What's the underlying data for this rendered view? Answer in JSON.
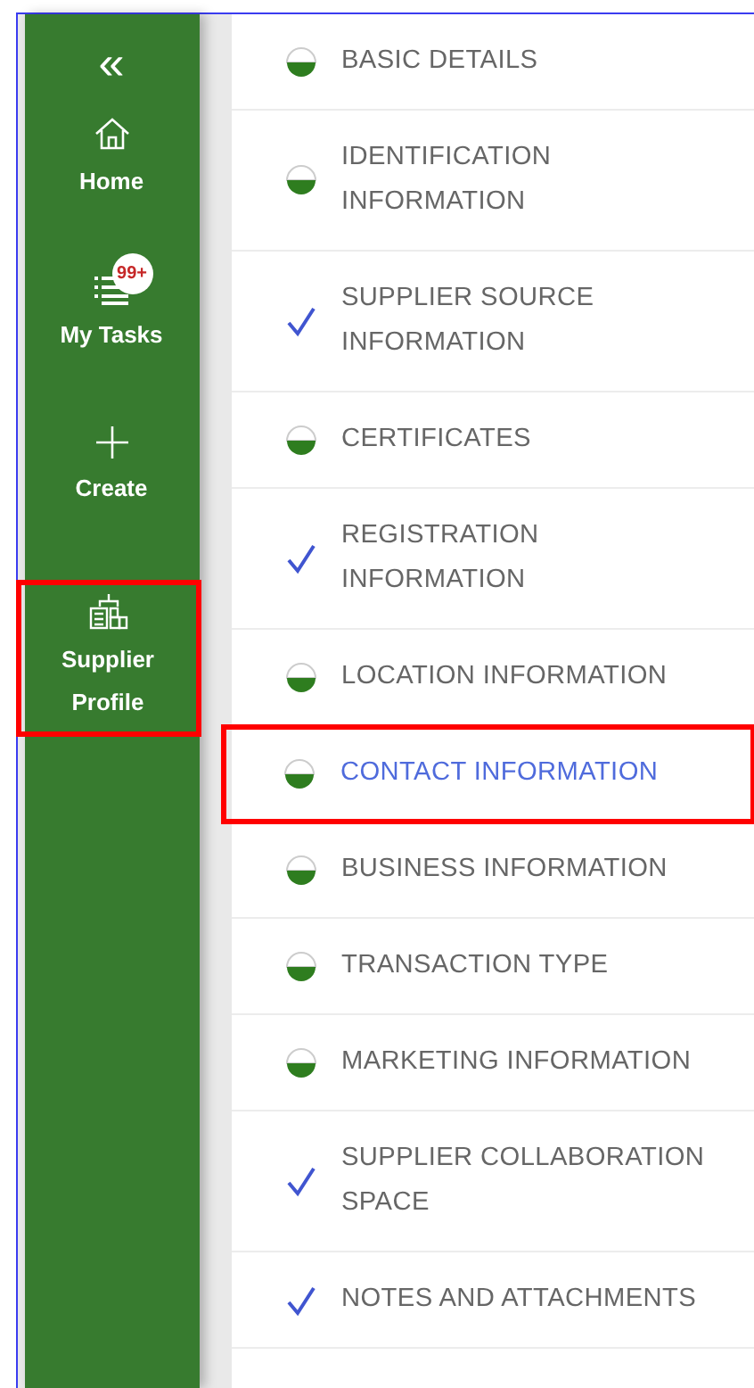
{
  "sidebar": {
    "collapse_icon": "«",
    "items": [
      {
        "kind": "home",
        "label": "Home",
        "highlighted": false
      },
      {
        "kind": "tasks",
        "label": "My Tasks",
        "badge": "99+",
        "highlighted": false
      },
      {
        "kind": "create",
        "label": "Create",
        "highlighted": false
      },
      {
        "kind": "supplier",
        "label": "Supplier Profile",
        "highlighted": true
      }
    ]
  },
  "sections": [
    {
      "label": "BASIC DETAILS",
      "kind": "partial",
      "selected": false,
      "highlighted": false
    },
    {
      "label": "IDENTIFICATION INFORMATION",
      "kind": "partial",
      "selected": false,
      "highlighted": false
    },
    {
      "label": "SUPPLIER SOURCE INFORMATION",
      "kind": "complete",
      "selected": false,
      "highlighted": false
    },
    {
      "label": "CERTIFICATES",
      "kind": "partial",
      "selected": false,
      "highlighted": false
    },
    {
      "label": "REGISTRATION INFORMATION",
      "kind": "complete",
      "selected": false,
      "highlighted": false
    },
    {
      "label": "LOCATION INFORMATION",
      "kind": "partial",
      "selected": false,
      "highlighted": false
    },
    {
      "label": "CONTACT INFORMATION",
      "kind": "partial",
      "selected": true,
      "highlighted": true
    },
    {
      "label": "BUSINESS INFORMATION",
      "kind": "partial",
      "selected": false,
      "highlighted": false
    },
    {
      "label": "TRANSACTION TYPE",
      "kind": "partial",
      "selected": false,
      "highlighted": false
    },
    {
      "label": "MARKETING INFORMATION",
      "kind": "partial",
      "selected": false,
      "highlighted": false
    },
    {
      "label": "SUPPLIER COLLABORATION SPACE",
      "kind": "complete",
      "selected": false,
      "highlighted": false
    },
    {
      "label": "NOTES AND ATTACHMENTS",
      "kind": "complete",
      "selected": false,
      "highlighted": false
    }
  ]
}
